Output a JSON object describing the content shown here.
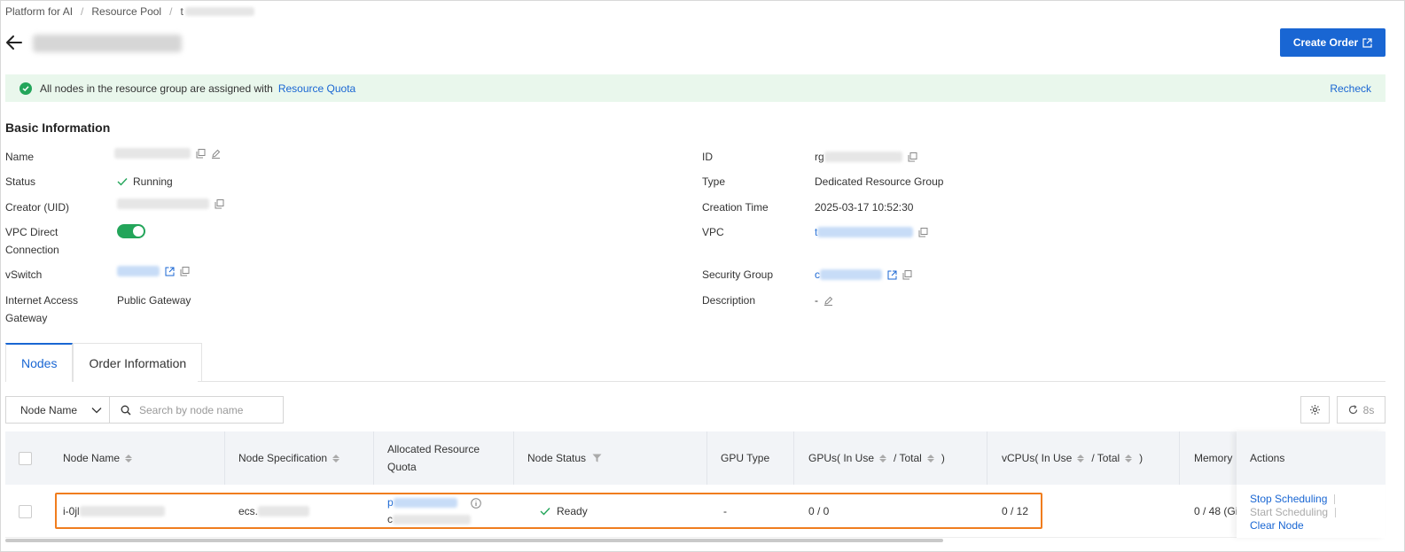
{
  "breadcrumb": {
    "item1": "Platform for AI",
    "item2": "Resource Pool",
    "item3": "t"
  },
  "header": {
    "create_order": "Create Order"
  },
  "banner": {
    "message": "All nodes in the resource group are assigned with",
    "link": "Resource Quota",
    "recheck": "Recheck"
  },
  "basic_info": {
    "title": "Basic Information",
    "name_label": "Name",
    "status_label": "Status",
    "status_value": "Running",
    "creator_label": "Creator (UID)",
    "vpc_direct_label": "VPC Direct Connection",
    "vswitch_label": "vSwitch",
    "internet_label": "Internet Access Gateway",
    "internet_value": "Public Gateway",
    "id_label": "ID",
    "id_value": "rg",
    "type_label": "Type",
    "type_value": "Dedicated Resource Group",
    "creation_time_label": "Creation Time",
    "creation_time_value": "2025-03-17 10:52:30",
    "vpc_label": "VPC",
    "vpc_value": "t",
    "security_group_label": "Security Group",
    "security_group_value": "c",
    "description_label": "Description",
    "description_value": "-"
  },
  "tabs": {
    "nodes": "Nodes",
    "order_info": "Order Information"
  },
  "filter": {
    "select_value": "Node Name",
    "search_placeholder": "Search by node name",
    "refresh_label": "8s"
  },
  "table": {
    "col_node_name": "Node Name",
    "col_spec": "Node Specification",
    "col_quota": "Allocated Resource Quota",
    "col_status": "Node Status",
    "col_gpu_type": "GPU Type",
    "col_gpus": "GPUs( In Use",
    "col_gpus_total": "/ Total",
    "col_gpus_end": ")",
    "col_vcpus": "vCPUs( In Use",
    "col_vcpus_total": "/ Total",
    "col_vcpus_end": ")",
    "col_memory": "Memory",
    "col_actions": "Actions",
    "row": {
      "node_name": "i-0jl",
      "spec": "ecs.",
      "quota_line1": "p",
      "quota_line2": "c",
      "status": "Ready",
      "gpu_type": "-",
      "gpus": "0 / 0",
      "vcpus": "0 / 12",
      "memory": "0 / 48 (Gi"
    },
    "actions": {
      "stop": "Stop Scheduling",
      "start": "Start Scheduling",
      "clear": "Clear Node"
    }
  },
  "colors": {
    "primary": "#1966d3",
    "success": "#23a55a",
    "highlight": "#f07d1e",
    "banner_bg": "#e9f7ec"
  }
}
